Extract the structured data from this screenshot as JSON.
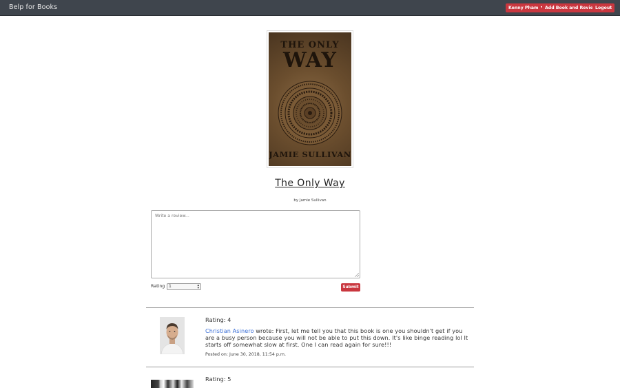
{
  "navbar": {
    "brand": "Belp for Books",
    "user_menu": "Kenny Pham",
    "add_button": "Add Book and Review",
    "logout_button": "Logout"
  },
  "book": {
    "cover_title_small": "THE ONLY",
    "cover_title_big": "WAY",
    "cover_author": "JAMIE SULLIVAN",
    "title": "The Only Way",
    "byline": "by Jamie Sullivan"
  },
  "review_form": {
    "placeholder": "Write a review...",
    "rating_label": "Rating",
    "rating_value": "1",
    "submit_label": "Submit"
  },
  "reviews": [
    {
      "rating": "Rating: 4",
      "author": "Christian Asinero",
      "text": " wrote: First, let me tell you that this book is one you shouldn't get if you are a busy person because you will not be able to put this down. It's like binge reading lol It starts off somewhat slow at first. One I can read again for sure!!!",
      "posted": "Posted on: June 30, 2018, 11:54 p.m."
    },
    {
      "rating": "Rating: 5"
    }
  ],
  "colors": {
    "navbar_bg": "#3f454d",
    "accent_red": "#c9373f",
    "link_blue": "#3b6fd6"
  }
}
